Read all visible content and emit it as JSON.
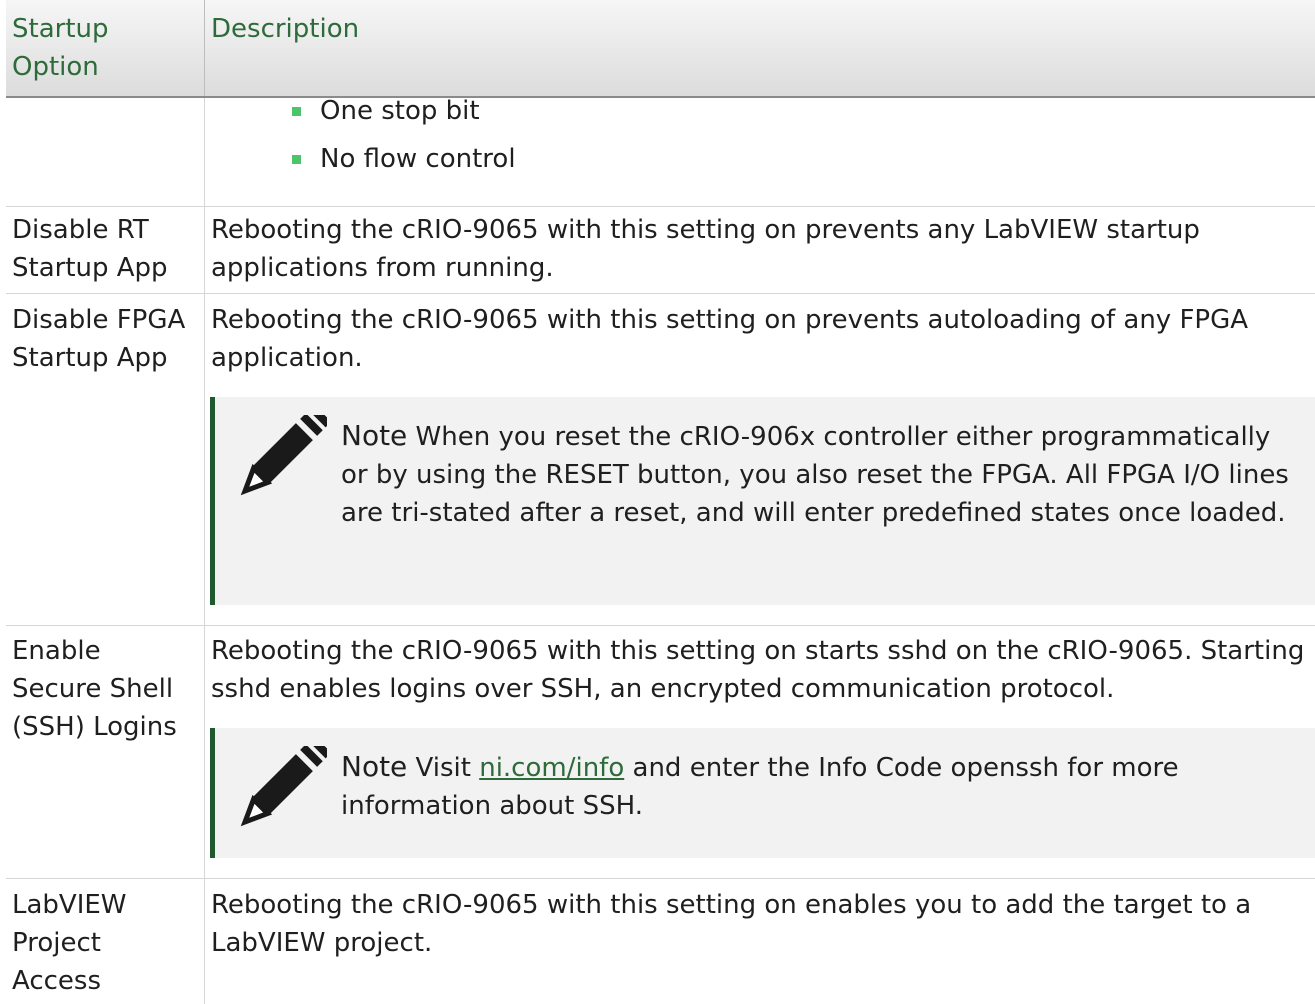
{
  "header": {
    "col1": "Startup\nOption",
    "col2": "Description"
  },
  "continued_bullets": [
    "One stop bit",
    "No flow control"
  ],
  "rows": [
    {
      "option": "Disable RT Startup App",
      "description": "Rebooting the cRIO-9065 with this setting on prevents any LabVIEW startup applications from running."
    },
    {
      "option": "Disable FPGA Startup App",
      "description": "Rebooting the cRIO-9065 with this setting on prevents autoloading of any FPGA application.",
      "note": {
        "label": "Note",
        "text": "When you reset the cRIO-906x controller either programmatically or by using the RESET button, you also reset the FPGA. All FPGA I/O lines are tri-stated after a reset, and will enter predefined states once loaded."
      }
    },
    {
      "option": "Enable Secure Shell (SSH) Logins",
      "description": "Rebooting the cRIO-9065 with this setting on starts sshd on the cRIO-9065. Starting sshd enables logins over SSH, an encrypted communication protocol.",
      "note": {
        "label": "Note",
        "pre": "Visit",
        "link": "ni.com/info",
        "post": "and enter the Info Code openssh for more information about SSH."
      }
    },
    {
      "option": "LabVIEW Project Access",
      "description": "Rebooting the cRIO-9065 with this setting on enables you to add the target to a LabVIEW project."
    }
  ]
}
